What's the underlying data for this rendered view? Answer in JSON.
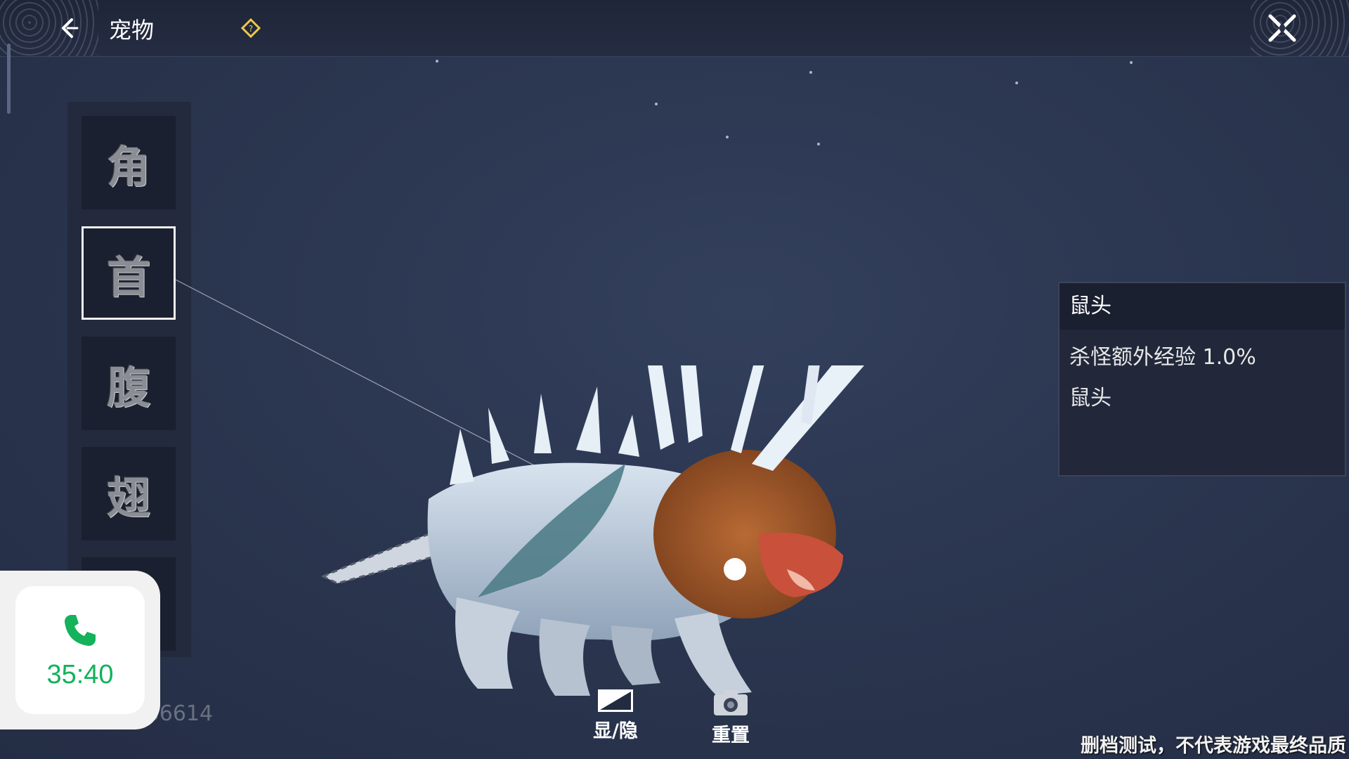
{
  "header": {
    "title": "宠物",
    "back_icon": "chevron-left-icon",
    "hint_icon": "diamond-hint-icon",
    "close_icon": "close-x-icon"
  },
  "part_tabs": [
    {
      "label": "角",
      "selected": false
    },
    {
      "label": "首",
      "selected": true
    },
    {
      "label": "腹",
      "selected": false
    },
    {
      "label": "翅",
      "selected": false
    },
    {
      "label": "",
      "selected": false
    }
  ],
  "info_panel": {
    "title": "鼠头",
    "effect": "杀怪额外经验 1.0%",
    "part_name": "鼠头"
  },
  "bottom_actions": {
    "toggle_label": "显/隐",
    "reset_label": "重置"
  },
  "uid_text": "1▇▇▇▇▇▇▇936614",
  "disclaimer": "删档测试，不代表游戏最终品质",
  "call": {
    "time": "35:40",
    "icon": "phone-icon",
    "accent": "#13b25b"
  }
}
